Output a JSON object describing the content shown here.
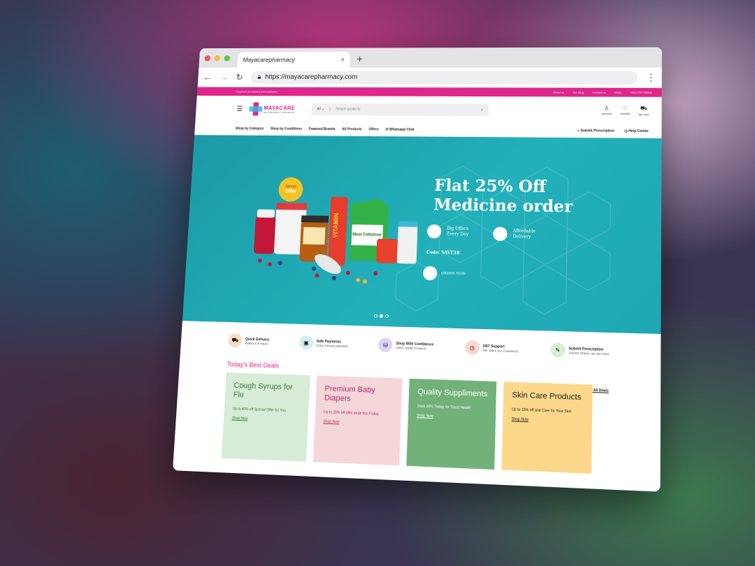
{
  "browser": {
    "tab_title": "Mayacarepharmacy",
    "tab_close": "×",
    "new_tab": "+",
    "url": "https://mayacarepharmacy.com",
    "lights": [
      "#ee5c55",
      "#f5bd41",
      "#5fc74a"
    ]
  },
  "topbar": {
    "notice": "Payment on delivery now available.",
    "links": [
      "About us",
      "Our Blog",
      "Contact us",
      "FAQs",
      "+254-707725898"
    ]
  },
  "header": {
    "logo_text": "MAYACARE",
    "logo_tag": "WE CARE ABOUT YOUR HEALTH",
    "search_category": "All",
    "search_placeholder": "Search products",
    "icons": [
      {
        "label": "Account",
        "icon": "user-icon"
      },
      {
        "label": "Wishlist",
        "icon": "heart-icon"
      },
      {
        "label": "My Cart",
        "icon": "cart-icon"
      }
    ]
  },
  "menu": {
    "items": [
      "Shop by Category",
      "Shop by Conditions",
      "Featured Brands",
      "All Products",
      "Offers",
      "Whatsapp Chat"
    ],
    "submit_prescription": "Submit Prescription",
    "help_center": "Help Center"
  },
  "hero": {
    "title_line1": "Flat 25% Off",
    "title_line2": "Medicine order",
    "badge": "Special Offer",
    "feature1": "Big Offers Every Day",
    "feature2": "Affordable Delivery",
    "code": "Code: SAVE18",
    "cta": "ORDER NOW",
    "product_labels": {
      "vitamin": "VITAMIN",
      "meal": "Meal Cellulose"
    },
    "slides": 3,
    "active_slide": 2
  },
  "features": [
    {
      "title": "Quick Delivery",
      "sub": "Within 2-3 Hours",
      "color": "#f9dcc5",
      "icon": "truck-icon",
      "glyph": "⛟"
    },
    {
      "title": "Safe Payments",
      "sub": "Enjoy Secure payment",
      "color": "#d2eef3",
      "icon": "payment-icon",
      "glyph": "▣"
    },
    {
      "title": "Shop With Confidence",
      "sub": "100% Qulity Products",
      "color": "#ddd5f3",
      "icon": "bag-icon",
      "glyph": "⛁"
    },
    {
      "title": "24/7 Support",
      "sub": "We Value our Customers",
      "color": "#fbd9cf",
      "icon": "support-icon",
      "glyph": "◷"
    },
    {
      "title": "Submit Prescription",
      "sub": "Submit Online, we are Here",
      "color": "#d6f0d4",
      "icon": "prescription-icon",
      "glyph": "✎"
    }
  ],
  "deals": {
    "title": "Today's Best Deals",
    "see_all": "See All Deals",
    "cards": [
      {
        "title": "Cough Syrups for Flu",
        "sub": "Up to 40% off Special Offer for You",
        "link": "Shop Now",
        "bg": "#d6ecd6",
        "fg": "#3c7d3c"
      },
      {
        "title": "Premium Baby Diapers",
        "sub": "Up to 25% off offer ends this Friday",
        "link": "Shop Now",
        "bg": "#f6d7d9",
        "fg": "#b42c6a"
      },
      {
        "title": "Quality Suppliments",
        "sub": "Save 30% Today, for Good Health",
        "link": "Shop Now",
        "bg": "#72b27a",
        "fg": "#ffffff"
      },
      {
        "title": "Skin Care Products",
        "sub": "Up to 15% off and Care for Your Skin",
        "link": "Shop Now",
        "bg": "#fbd88b",
        "fg": "#222222"
      }
    ]
  }
}
